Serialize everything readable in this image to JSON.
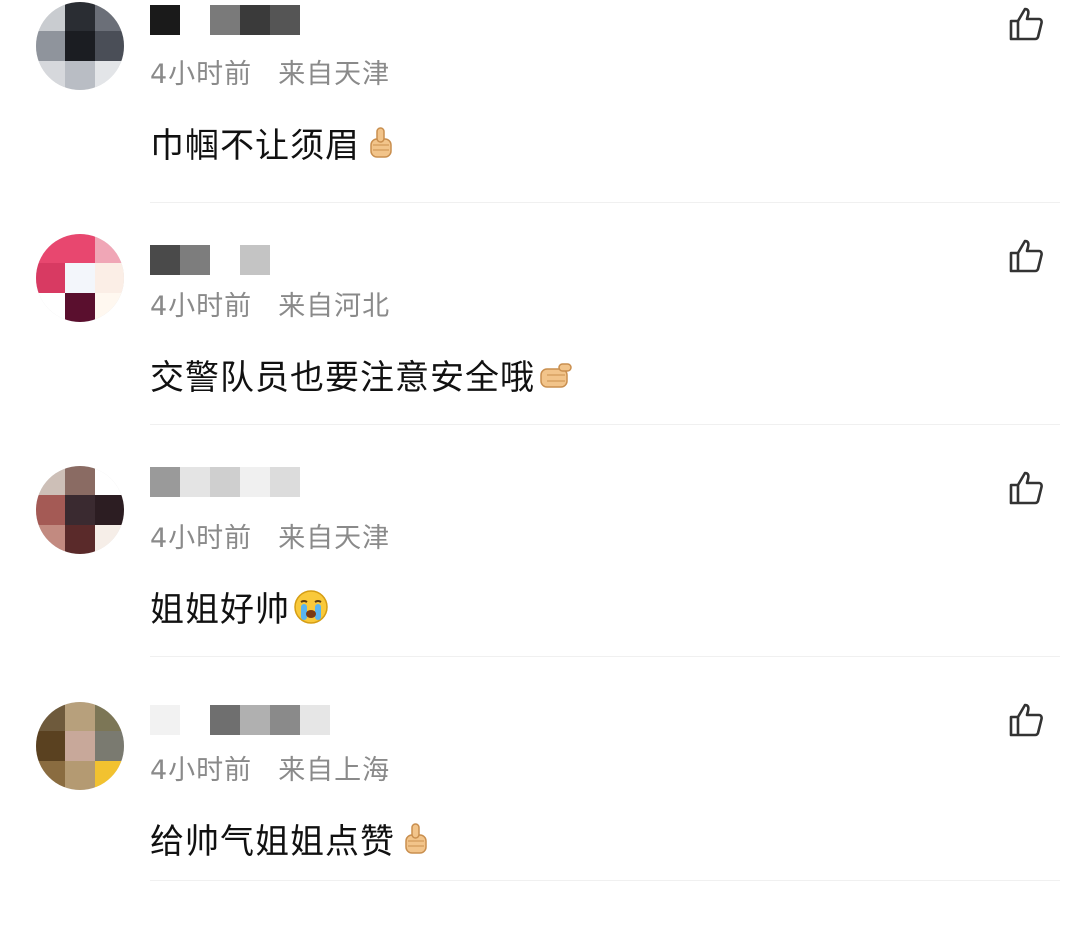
{
  "comments": [
    {
      "time": "4小时前",
      "location": "来自天津",
      "text": "巾帼不让须眉",
      "emoji": "thumbs-up-icon"
    },
    {
      "time": "4小时前",
      "location": "来自河北",
      "text": "交警队员也要注意安全哦",
      "emoji": "thumbs-up-sideways-icon"
    },
    {
      "time": "4小时前",
      "location": "来自天津",
      "text": "姐姐好帅",
      "emoji": "crying-face-icon"
    },
    {
      "time": "4小时前",
      "location": "来自上海",
      "text": "给帅气姐姐点赞",
      "emoji": "thumbs-up-icon"
    }
  ],
  "colors": {
    "meta_text": "#8a8a8a",
    "body_text": "#111111",
    "like_icon": "#333333"
  }
}
